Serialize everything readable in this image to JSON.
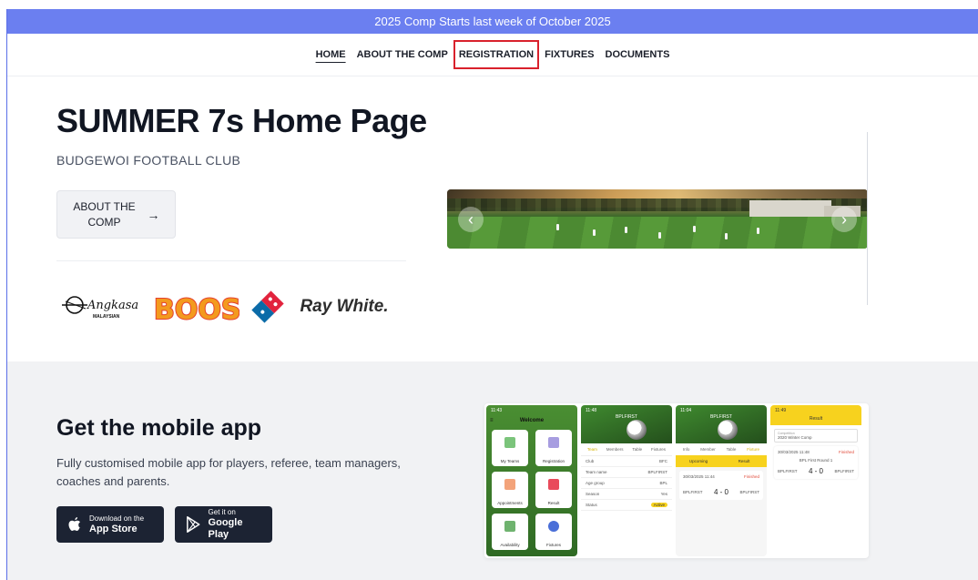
{
  "banner": {
    "text": "2025 Comp Starts last week of October 2025"
  },
  "nav": {
    "items": [
      {
        "label": "HOME"
      },
      {
        "label": "ABOUT THE COMP"
      },
      {
        "label": "REGISTRATION"
      },
      {
        "label": "FIXTURES"
      },
      {
        "label": "DOCUMENTS"
      }
    ]
  },
  "hero": {
    "title": "SUMMER 7s Home Page",
    "subtitle": "BUDGEWOI FOOTBALL CLUB",
    "about_button": "ABOUT THE COMP",
    "about_arrow": "→"
  },
  "sponsors": [
    {
      "name": "Angkasa",
      "sub": "MALAYSIAN"
    },
    {
      "name": "BOOST"
    },
    {
      "name": "Domino's"
    },
    {
      "name": "Ray White."
    }
  ],
  "carousel": {
    "prev": "‹",
    "next": "›"
  },
  "mobile_app": {
    "title": "Get the mobile app",
    "description": "Fully customised mobile app for players, referee, team managers, coaches and parents.",
    "app_store": {
      "small": "Download on the",
      "big": "App Store"
    },
    "google_play": {
      "small": "Get it on",
      "big": "Google Play"
    }
  },
  "phones": {
    "p1": {
      "time": "11:43",
      "title": "Welcome",
      "tiles": [
        "My Teams",
        "Registration",
        "Appointments",
        "Result",
        "Availability",
        "Fixtures"
      ]
    },
    "p2": {
      "time": "11:48",
      "title": "BPLFIRST",
      "tabs": [
        "Team",
        "Members",
        "Table",
        "Fixtures"
      ],
      "rows": [
        {
          "k": "Club",
          "v": "BFC"
        },
        {
          "k": "Team name",
          "v": "BPLFIRST"
        },
        {
          "k": "Age group",
          "v": "BPL"
        },
        {
          "k": "Season",
          "v": "Yes"
        },
        {
          "k": "Status",
          "v": "Active"
        }
      ]
    },
    "p3": {
      "time": "11:04",
      "title": "BPLFIRST",
      "tabs": [
        "Info",
        "Member",
        "Table",
        "Fixture"
      ],
      "subtabs": [
        "Upcoming",
        "Result"
      ],
      "date": "30/03/2025 11:44",
      "status": "Finished",
      "home": "BPLFIRST",
      "away": "BPLFIRST",
      "score": "4 - 0"
    },
    "p4": {
      "time": "11:49",
      "title": "Result",
      "competition_label": "Competition",
      "competition": "2020 Winter Comp",
      "date": "30/03/2025 11:48",
      "status": "Finished",
      "round": "BPL First Round 1",
      "home": "BPLFIRST",
      "away": "BPLFIRST",
      "score": "4 - 0"
    }
  },
  "colors": {
    "banner": "#6b7ff0",
    "highlight_box": "#d9212c",
    "store_button": "#1c2333",
    "app_accent": "#f7d21e",
    "app_green": "#3f8a2f"
  }
}
